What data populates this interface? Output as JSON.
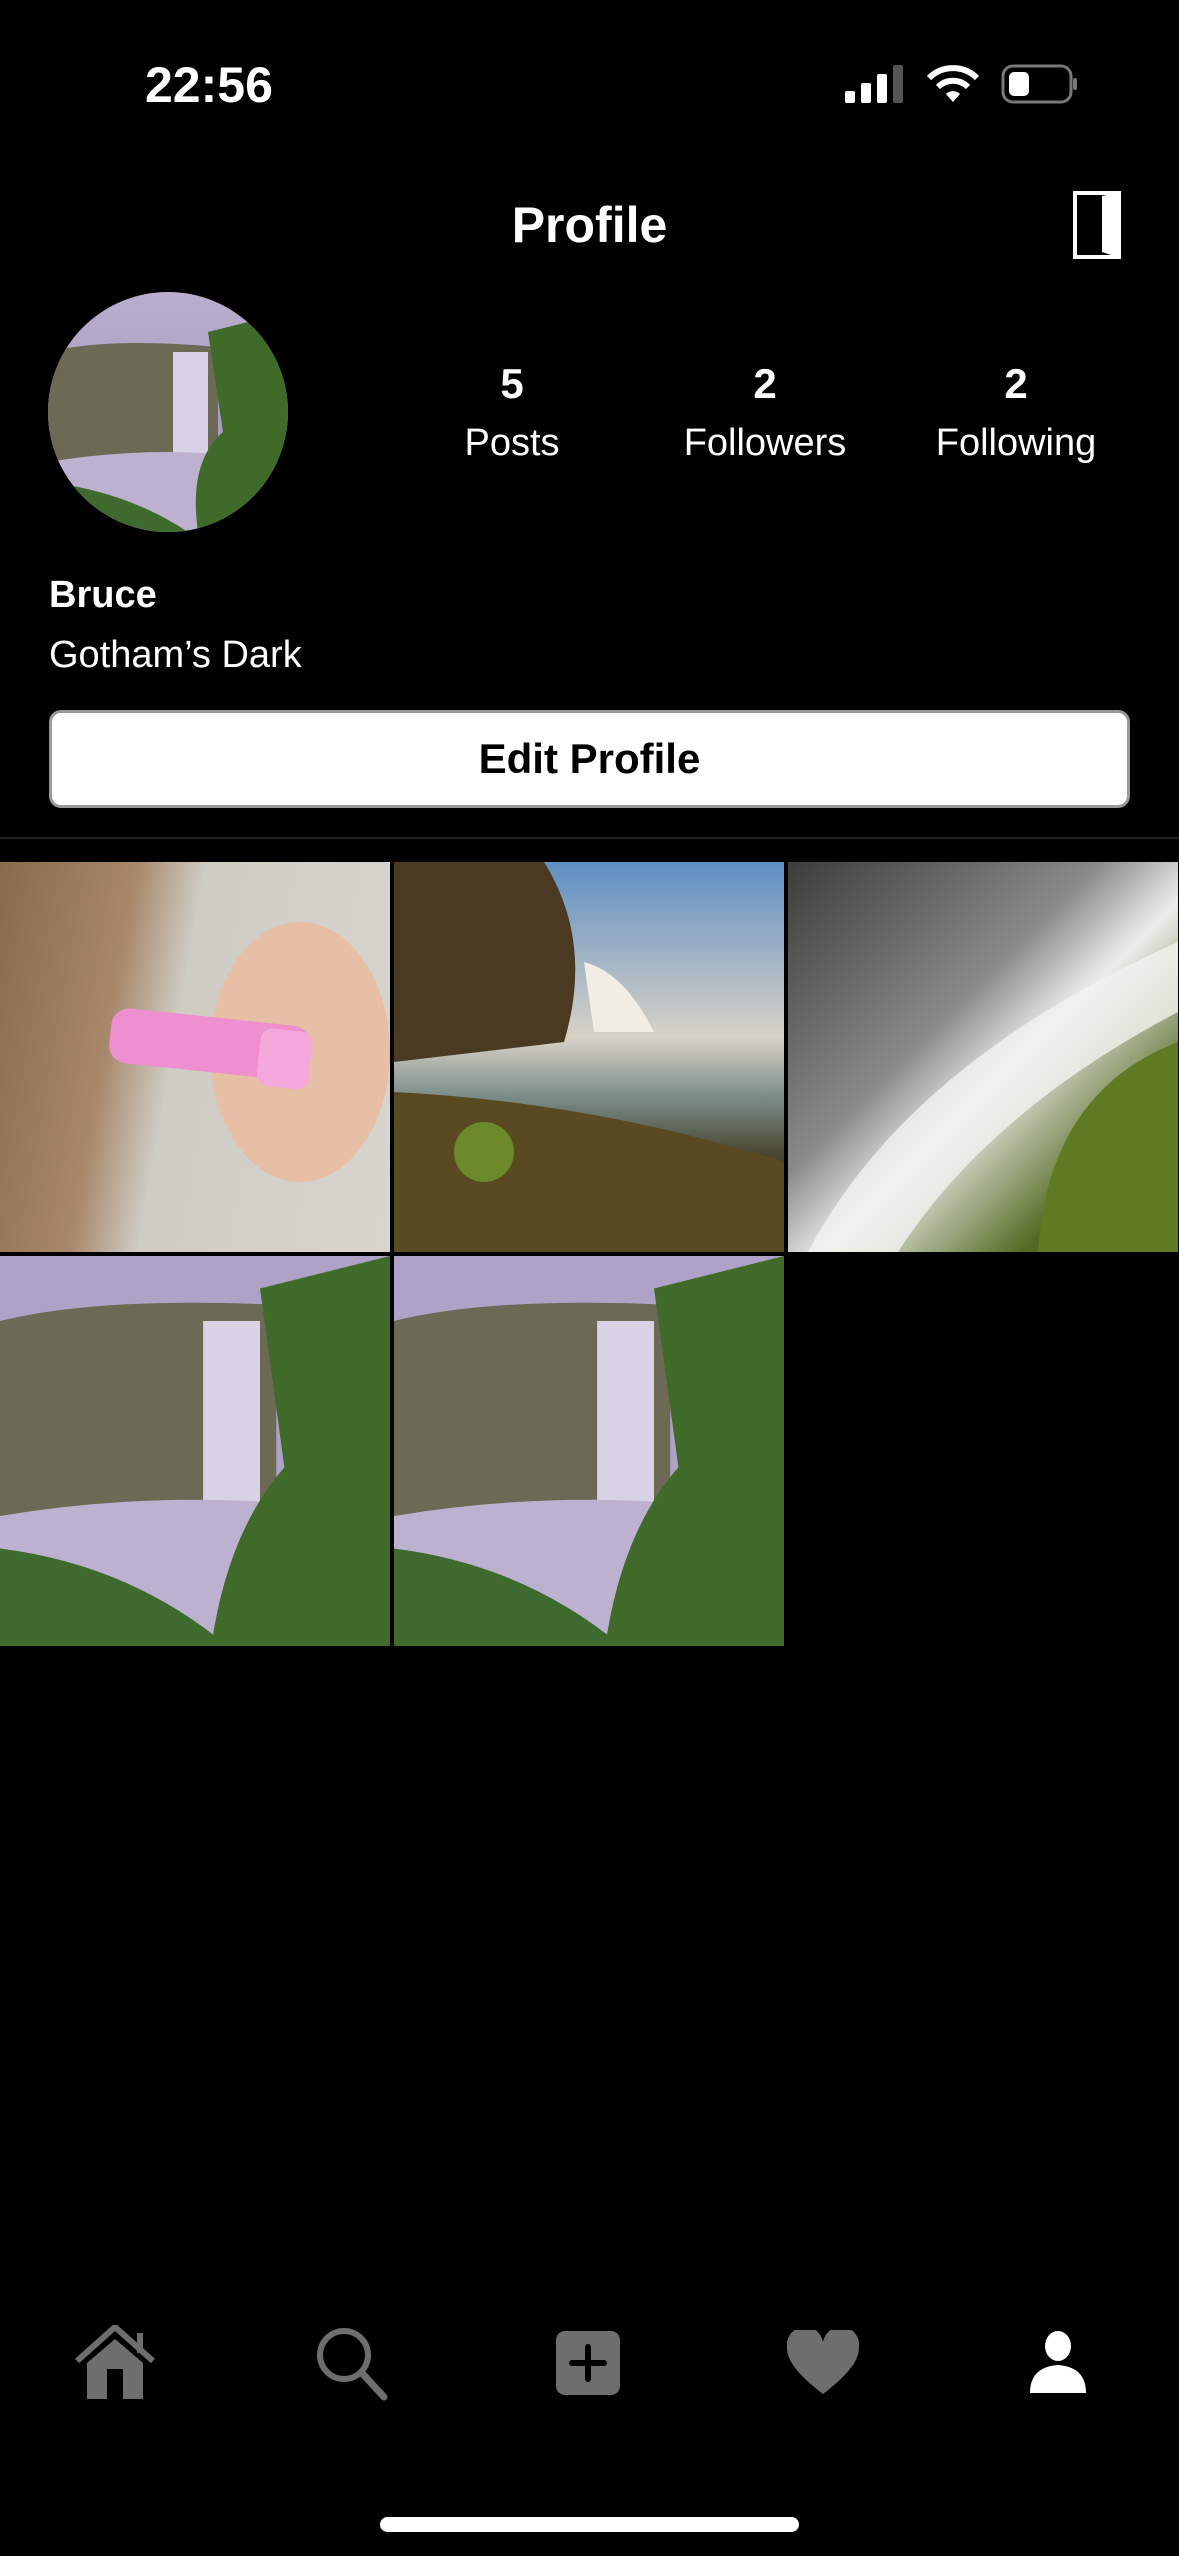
{
  "status_bar": {
    "time": "22:56",
    "icons": [
      "signal-icon",
      "wifi-icon",
      "battery-icon"
    ]
  },
  "header": {
    "title": "Profile",
    "action_icon": "door-logout-icon"
  },
  "profile": {
    "name": "Bruce",
    "bio": "Gotham’s Dark",
    "stats": [
      {
        "value": "5",
        "label": "Posts"
      },
      {
        "value": "2",
        "label": "Followers"
      },
      {
        "value": "2",
        "label": "Following"
      }
    ],
    "edit_label": "Edit Profile"
  },
  "posts": [
    "lip balm in hand",
    "waterfall at sunset",
    "waterfall over mossy rocks",
    "waterfall in mist",
    "waterfall in mist"
  ],
  "tab_bar": {
    "items": [
      "home-icon",
      "search-icon",
      "add-post-icon",
      "heart-icon",
      "profile-icon"
    ],
    "active": "profile-icon",
    "inactive_color": "#6e6e6e",
    "active_color": "#ffffff"
  }
}
